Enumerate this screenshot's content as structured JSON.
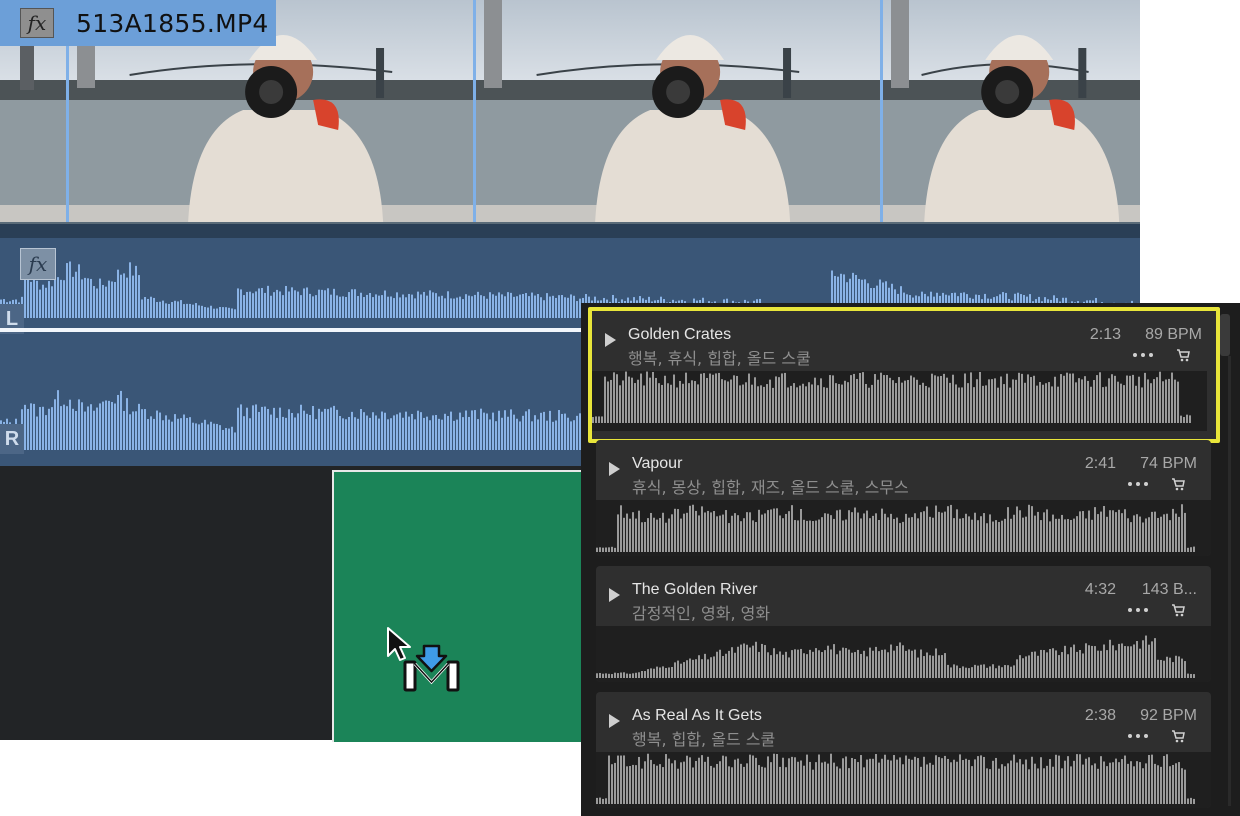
{
  "video_clip": {
    "name": "513A1855.MP4",
    "fx_label": "fx"
  },
  "audio_clip": {
    "fx_label": "fx",
    "left_channel_label": "L",
    "right_channel_label": "R"
  },
  "music_library": {
    "tracks": [
      {
        "title": "Golden Crates",
        "tags": "행복, 휴식, 힙합, 올드 스쿨",
        "duration": "2:13",
        "bpm": "89 BPM",
        "selected": true
      },
      {
        "title": "Vapour",
        "tags": "휴식, 몽상, 힙합, 재즈, 올드 스쿨, 스무스",
        "duration": "2:41",
        "bpm": "74 BPM",
        "selected": false
      },
      {
        "title": "The Golden River",
        "tags": "감정적인, 영화, 영화",
        "duration": "4:32",
        "bpm": "143 B...",
        "selected": false
      },
      {
        "title": "As Real As It Gets",
        "tags": "행복, 힙합, 올드 스쿨",
        "duration": "2:38",
        "bpm": "92 BPM",
        "selected": false
      }
    ]
  },
  "colors": {
    "selection_highlight": "#e8e53a",
    "drop_target": "#1b8458",
    "video_clip_label": "#6c9fd8",
    "audio_track": "#3a5677"
  },
  "icons": [
    "fx-icon",
    "play-icon",
    "more-icon",
    "cart-icon",
    "insert-cursor-icon"
  ]
}
